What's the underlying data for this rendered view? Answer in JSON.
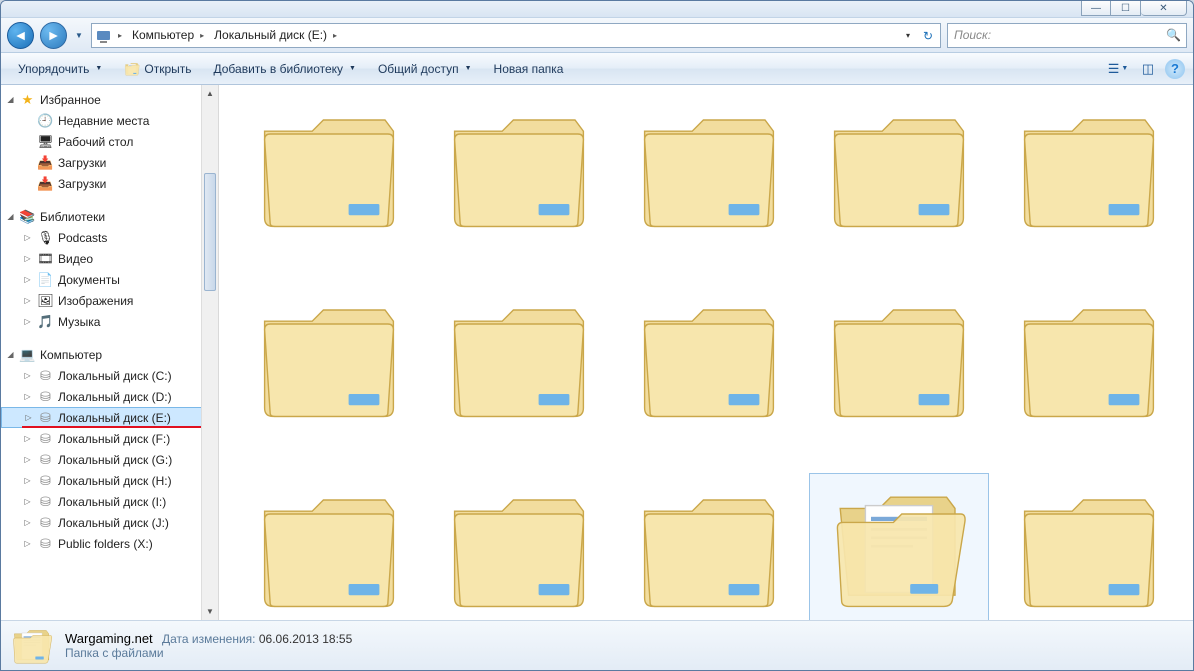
{
  "window_controls": {
    "min": "—",
    "max": "☐",
    "close": "✕"
  },
  "breadcrumb": {
    "seg1": "Компьютер",
    "seg2": "Локальный диск (E:)"
  },
  "search": {
    "placeholder": "Поиск:"
  },
  "toolbar": {
    "organize": "Упорядочить",
    "open": "Открыть",
    "add_lib": "Добавить в библиотеку",
    "share": "Общий доступ",
    "new_folder": "Новая папка"
  },
  "sidebar": {
    "favorites": {
      "title": "Избранное",
      "items": [
        "Недавние места",
        "Рабочий стол",
        "Загрузки",
        "Загрузки"
      ]
    },
    "libraries": {
      "title": "Библиотеки",
      "items": [
        "Podcasts",
        "Видео",
        "Документы",
        "Изображения",
        "Музыка"
      ]
    },
    "computer": {
      "title": "Компьютер",
      "drives": [
        "Локальный диск (C:)",
        "Локальный диск (D:)",
        "Локальный диск (E:)",
        "Локальный диск (F:)",
        "Локальный диск (G:)",
        "Локальный диск (H:)",
        "Локальный диск (I:)",
        "Локальный диск (J:)",
        "Public folders (X:)"
      ],
      "selected_index": 2
    }
  },
  "folders": {
    "visible_count": 15,
    "selected_index": 13,
    "selected_label": "Wargaming.net"
  },
  "status": {
    "name": "Wargaming.net",
    "type": "Папка с файлами",
    "mod_label": "Дата изменения:",
    "mod_value": "06.06.2013 18:55"
  }
}
